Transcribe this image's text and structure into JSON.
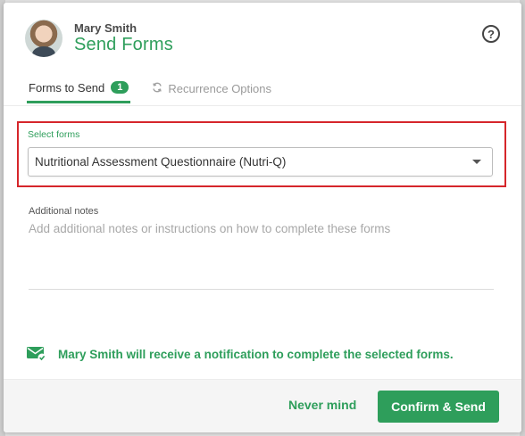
{
  "header": {
    "patient_name": "Mary Smith",
    "title": "Send Forms",
    "help_glyph": "?"
  },
  "tabs": [
    {
      "label": "Forms to Send",
      "badge": "1",
      "active": true
    },
    {
      "label": "Recurrence Options",
      "icon": "refresh-icon",
      "active": false
    }
  ],
  "select": {
    "label": "Select forms",
    "value": "Nutritional Assessment Questionnaire (Nutri-Q)"
  },
  "notes": {
    "label": "Additional notes",
    "placeholder": "Add additional notes or instructions on how to complete these forms"
  },
  "notice": {
    "text": "Mary Smith will receive a notification to complete the selected forms.",
    "icon": "envelope-check-icon"
  },
  "footer": {
    "cancel_label": "Never mind",
    "confirm_label": "Confirm & Send"
  },
  "colors": {
    "accent": "#2e9e5b",
    "highlight_border": "#d6262b"
  }
}
